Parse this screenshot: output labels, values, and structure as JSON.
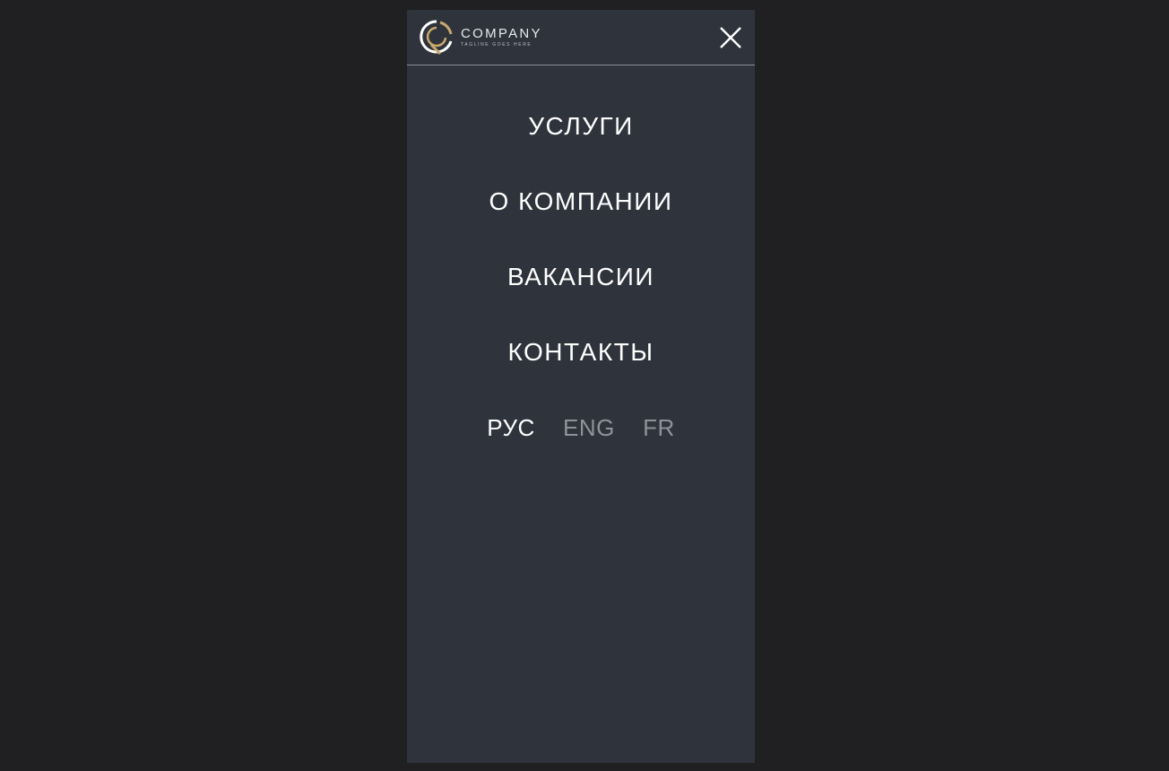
{
  "header": {
    "brand_name": "COMPANY",
    "brand_tagline": "TAGLINE GOES HERE",
    "logo_icon": "company-logo-ring",
    "close_icon": "close-icon"
  },
  "nav": {
    "items": [
      {
        "label": "УСЛУГИ"
      },
      {
        "label": "О КОМПАНИИ"
      },
      {
        "label": "ВАКАНСИИ"
      },
      {
        "label": "КОНТАКТЫ"
      }
    ]
  },
  "languages": {
    "options": [
      {
        "label": "РУС",
        "active": true
      },
      {
        "label": "ENG",
        "active": false
      },
      {
        "label": "FR",
        "active": false
      }
    ]
  },
  "colors": {
    "page_background": "#202022",
    "menu_background": "#2f343c",
    "logo_gold": "#c9a96a",
    "text_primary": "#ffffff",
    "text_muted": "#8e9399"
  }
}
